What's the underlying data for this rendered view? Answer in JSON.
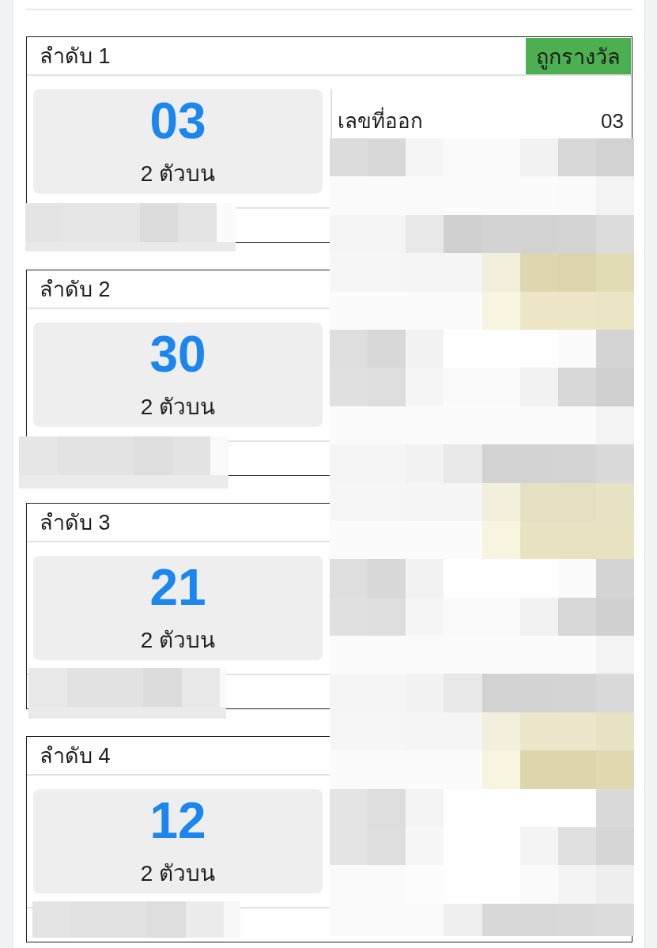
{
  "cards": [
    {
      "title": "ลำดับ 1",
      "badge": "ถูกรางวัล",
      "number": "03",
      "bet_type": "2 ตัวบน",
      "result": {
        "label": "เลขที่ออก",
        "value": "03"
      }
    },
    {
      "title": "ลำดับ 2",
      "number": "30",
      "bet_type": "2 ตัวบน"
    },
    {
      "title": "ลำดับ 3",
      "number": "21",
      "bet_type": "2 ตัวบน"
    },
    {
      "title": "ลำดับ 4",
      "number": "12",
      "bet_type": "2 ตัวบน"
    }
  ]
}
